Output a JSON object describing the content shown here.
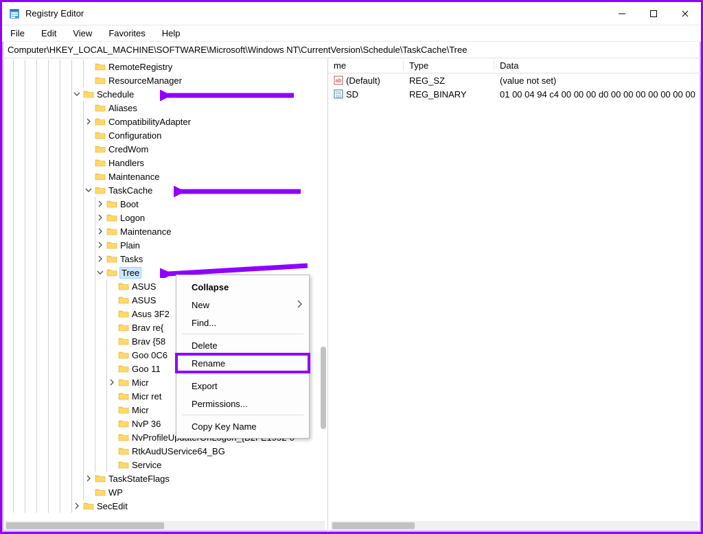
{
  "window": {
    "title": "Registry Editor",
    "menu": {
      "file": "File",
      "edit": "Edit",
      "view": "View",
      "favorites": "Favorites",
      "help": "Help"
    },
    "address": "Computer\\HKEY_LOCAL_MACHINE\\SOFTWARE\\Microsoft\\Windows NT\\CurrentVersion\\Schedule\\TaskCache\\Tree"
  },
  "tree": {
    "items": [
      {
        "indent": 7,
        "toggle": "none",
        "label": "RemoteRegistry"
      },
      {
        "indent": 7,
        "toggle": "none",
        "label": "ResourceManager"
      },
      {
        "indent": 6,
        "toggle": "open",
        "label": "Schedule"
      },
      {
        "indent": 7,
        "toggle": "none",
        "label": "Aliases"
      },
      {
        "indent": 7,
        "toggle": "closed",
        "label": "CompatibilityAdapter"
      },
      {
        "indent": 7,
        "toggle": "none",
        "label": "Configuration"
      },
      {
        "indent": 7,
        "toggle": "none",
        "label": "CredWom"
      },
      {
        "indent": 7,
        "toggle": "none",
        "label": "Handlers"
      },
      {
        "indent": 7,
        "toggle": "none",
        "label": "Maintenance"
      },
      {
        "indent": 7,
        "toggle": "open",
        "label": "TaskCache"
      },
      {
        "indent": 8,
        "toggle": "closed",
        "label": "Boot"
      },
      {
        "indent": 8,
        "toggle": "closed",
        "label": "Logon"
      },
      {
        "indent": 8,
        "toggle": "closed",
        "label": "Maintenance"
      },
      {
        "indent": 8,
        "toggle": "closed",
        "label": "Plain"
      },
      {
        "indent": 8,
        "toggle": "closed",
        "label": "Tasks"
      },
      {
        "indent": 8,
        "toggle": "open",
        "label": "Tree",
        "selected": true
      },
      {
        "indent": 9,
        "toggle": "none",
        "label": "ASUS"
      },
      {
        "indent": 9,
        "toggle": "none",
        "label": "ASUS"
      },
      {
        "indent": 9,
        "toggle": "none",
        "label": "Asus                                                          3F2"
      },
      {
        "indent": 9,
        "toggle": "none",
        "label": "Brav                                                            re{"
      },
      {
        "indent": 9,
        "toggle": "none",
        "label": "Brav                                                           {58"
      },
      {
        "indent": 9,
        "toggle": "none",
        "label": "Goo                                                            0C6"
      },
      {
        "indent": 9,
        "toggle": "none",
        "label": "Goo                                                              11"
      },
      {
        "indent": 9,
        "toggle": "closed",
        "label": "Micr"
      },
      {
        "indent": 9,
        "toggle": "none",
        "label": "Micr                                                            ret"
      },
      {
        "indent": 9,
        "toggle": "none",
        "label": "Micr"
      },
      {
        "indent": 9,
        "toggle": "none",
        "label": "NvP                                                                  36"
      },
      {
        "indent": 9,
        "toggle": "none",
        "label": "NvProfileUpdaterOnLogon_{B2FE1952-0"
      },
      {
        "indent": 9,
        "toggle": "none",
        "label": "RtkAudUService64_BG"
      },
      {
        "indent": 9,
        "toggle": "none",
        "label": "Service"
      },
      {
        "indent": 7,
        "toggle": "closed",
        "label": "TaskStateFlags"
      },
      {
        "indent": 7,
        "toggle": "none",
        "label": "WP"
      },
      {
        "indent": 6,
        "toggle": "closed",
        "label": "SecEdit"
      }
    ]
  },
  "right": {
    "columns": {
      "name": "me",
      "type": "Type",
      "data": "Data"
    },
    "rows": [
      {
        "name": "(Default)",
        "type": "REG_SZ",
        "data": "(value not set)",
        "iconType": "string"
      },
      {
        "name": "SD",
        "type": "REG_BINARY",
        "data": "01 00 04 94 c4 00 00 00 d0 00 00 00 00 00 00 00",
        "iconType": "binary"
      }
    ]
  },
  "contextMenu": {
    "items": {
      "collapse": "Collapse",
      "new": "New",
      "find": "Find...",
      "delete": "Delete",
      "rename": "Rename",
      "export": "Export",
      "permissions": "Permissions...",
      "copyKeyName": "Copy Key Name"
    }
  }
}
